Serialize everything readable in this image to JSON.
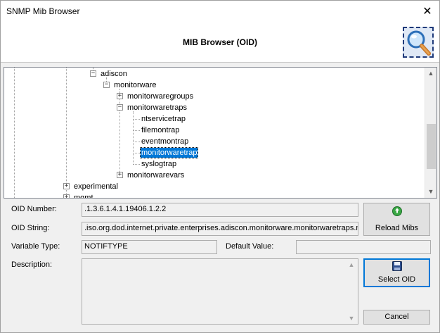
{
  "window": {
    "title": "SNMP Mib Browser",
    "close_glyph": "✕"
  },
  "header": {
    "title": "MIB Browser (OID)",
    "icon": "magnifier-icon"
  },
  "tree": {
    "nodes": [
      {
        "label": "adiscon",
        "expander": "−"
      },
      {
        "label": "monitorware",
        "expander": "−"
      },
      {
        "label": "monitorwaregroups",
        "expander": "+"
      },
      {
        "label": "monitorwaretraps",
        "expander": "−"
      },
      {
        "label": "ntservicetrap"
      },
      {
        "label": "filemontrap"
      },
      {
        "label": "eventmontrap"
      },
      {
        "label": "monitorwaretrap",
        "selected": true
      },
      {
        "label": "syslogtrap"
      },
      {
        "label": "monitorwarevars",
        "expander": "+"
      },
      {
        "label": "experimental",
        "expander": "+"
      },
      {
        "label": "mgmt",
        "expander": "+"
      }
    ]
  },
  "form": {
    "oid_number_label": "OID Number:",
    "oid_number_value": ".1.3.6.1.4.1.19406.1.2.2",
    "oid_string_label": "OID String:",
    "oid_string_value": ".iso.org.dod.internet.private.enterprises.adiscon.monitorware.monitorwaretraps.monitorwaretrap",
    "variable_type_label": "Variable Type:",
    "variable_type_value": "NOTIFTYPE",
    "default_value_label": "Default Value:",
    "default_value_value": "",
    "description_label": "Description:",
    "description_value": ""
  },
  "buttons": {
    "reload_mibs": "Reload Mibs",
    "select_oid": "Select OID",
    "cancel": "Cancel"
  },
  "colors": {
    "selection": "#0078d7",
    "accent_border": "#0078d7"
  }
}
